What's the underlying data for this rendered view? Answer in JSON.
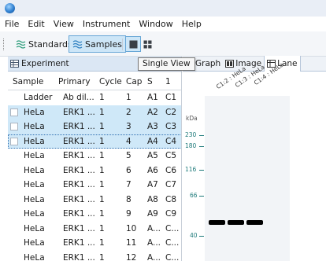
{
  "menu": [
    "File",
    "Edit",
    "View",
    "Instrument",
    "Window",
    "Help"
  ],
  "toolbar": {
    "standards_label": "Standards",
    "samples_label": "Samples",
    "single_view_icon": "single-view-icon",
    "multi_view_icon": "multi-view-icon"
  },
  "tooltip": "Single View",
  "experiment": {
    "tab_label": "Experiment",
    "columns": [
      "Sample",
      "Primary",
      "Cycle",
      "Cap",
      "S",
      "1"
    ],
    "rows": [
      {
        "sample": "Ladder",
        "primary": "Ab dil...",
        "cycle": "1",
        "cap": "1",
        "s": "A1",
        "last": "C1"
      },
      {
        "sample": "HeLa",
        "primary": "ERK1 ...",
        "cycle": "1",
        "cap": "2",
        "s": "A2",
        "last": "C2"
      },
      {
        "sample": "HeLa",
        "primary": "ERK1 ...",
        "cycle": "1",
        "cap": "3",
        "s": "A3",
        "last": "C3"
      },
      {
        "sample": "HeLa",
        "primary": "ERK1 ...",
        "cycle": "1",
        "cap": "4",
        "s": "A4",
        "last": "C4"
      },
      {
        "sample": "HeLa",
        "primary": "ERK1 ...",
        "cycle": "1",
        "cap": "5",
        "s": "A5",
        "last": "C5"
      },
      {
        "sample": "HeLa",
        "primary": "ERK1 ...",
        "cycle": "1",
        "cap": "6",
        "s": "A6",
        "last": "C6"
      },
      {
        "sample": "HeLa",
        "primary": "ERK1 ...",
        "cycle": "1",
        "cap": "7",
        "s": "A7",
        "last": "C7"
      },
      {
        "sample": "HeLa",
        "primary": "ERK1 ...",
        "cycle": "1",
        "cap": "8",
        "s": "A8",
        "last": "C8"
      },
      {
        "sample": "HeLa",
        "primary": "ERK1 ...",
        "cycle": "1",
        "cap": "9",
        "s": "A9",
        "last": "C9"
      },
      {
        "sample": "HeLa",
        "primary": "ERK1 ...",
        "cycle": "1",
        "cap": "10",
        "s": "A...",
        "last": "C..."
      },
      {
        "sample": "HeLa",
        "primary": "ERK1 ...",
        "cycle": "1",
        "cap": "11",
        "s": "A...",
        "last": "C..."
      },
      {
        "sample": "HeLa",
        "primary": "ERK1 ...",
        "cycle": "1",
        "cap": "12",
        "s": "A...",
        "last": "C..."
      }
    ],
    "selected_rows": [
      1,
      2,
      3
    ],
    "focused_row": 3
  },
  "right_tabs": [
    {
      "label": "Graph",
      "icon": "graph-icon"
    },
    {
      "label": "Image",
      "icon": "image-icon"
    },
    {
      "label": "Lane",
      "icon": "lane-icon"
    }
  ],
  "lane_view": {
    "unit_label": "kDa",
    "lanes": [
      "C1:2 : HeLa",
      "C1:3 : HeLa",
      "C1:4 : HeLa"
    ],
    "markers": [
      "230",
      "180",
      "116",
      "66",
      "40"
    ]
  },
  "colors": {
    "selection": "#cfe8f8",
    "marker_text": "#1e7a7a",
    "tab_bg": "#dbe7f4"
  }
}
